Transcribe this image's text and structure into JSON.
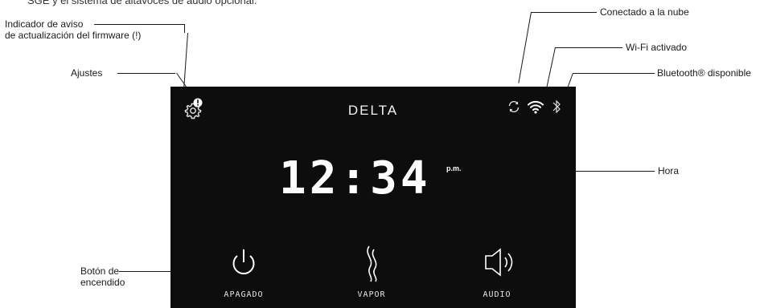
{
  "top_cut_text": "SGE y el sistema de altavoces de audio opcional.",
  "callouts": {
    "firmware": "Indicador de aviso\nde actualización del firmware (!)",
    "settings": "Ajustes",
    "power": "Botón de\nencendido",
    "cloud": "Conectado a la nube",
    "wifi": "Wi-Fi activado",
    "bluetooth": "Bluetooth® disponible",
    "time": "Hora"
  },
  "display": {
    "brand": "DELTA",
    "time": "12:34",
    "ampm": "p.m."
  },
  "buttons": [
    {
      "label": "APAGADO",
      "icon": "power-icon"
    },
    {
      "label": "VAPOR",
      "icon": "steam-icon"
    },
    {
      "label": "AUDIO",
      "icon": "speaker-icon"
    }
  ],
  "status_icons": [
    "sync-icon",
    "wifi-icon",
    "bluetooth-icon"
  ],
  "colors": {
    "panel": "#0d0d0d",
    "text_on_panel": "#ffffff",
    "leader": "#1a1a1a"
  }
}
